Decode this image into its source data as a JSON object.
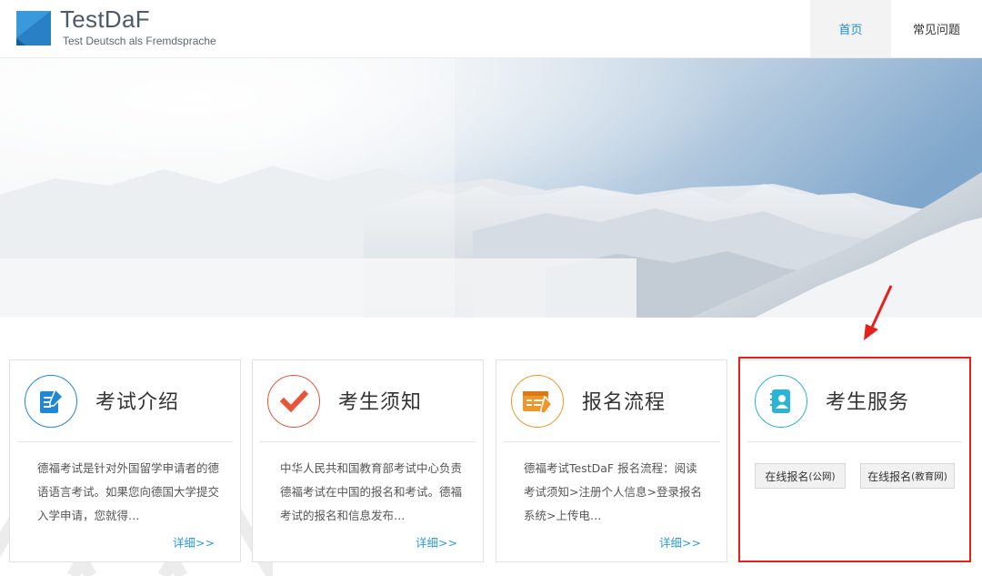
{
  "header": {
    "logo_title": "TestDaF",
    "logo_subtitle": "Test Deutsch als Fremdsprache",
    "nav": [
      {
        "label": "首页",
        "active": true
      },
      {
        "label": "常见问题",
        "active": false
      }
    ]
  },
  "cards": [
    {
      "title": "考试介绍",
      "icon": "document-edit-icon",
      "color": "#1e88d6",
      "text": "德福考试是针对外国留学申请者的德语语言考试。如果您向德国大学提交入学申请，您就得…",
      "more": "详细>>"
    },
    {
      "title": "考生须知",
      "icon": "checkmark-icon",
      "color": "#e8553a",
      "text": "中华人民共和国教育部考试中心负责德福考试在中国的报名和考试。德福考试的报名和信息发布…",
      "more": "详细>>"
    },
    {
      "title": "报名流程",
      "icon": "form-pen-icon",
      "color": "#f0962a",
      "text": "德福考试TestDaF 报名流程：阅读考试须知>注册个人信息>登录报名系统>上传电…",
      "more": "详细>>"
    },
    {
      "title": "考生服务",
      "icon": "contact-book-icon",
      "color": "#2ab4d8",
      "buttons": [
        {
          "main": "在线报名",
          "paren": "(公网)"
        },
        {
          "main": "在线报名",
          "paren": "(教育网)"
        }
      ]
    }
  ]
}
